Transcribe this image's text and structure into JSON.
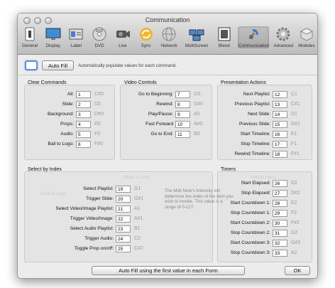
{
  "window": {
    "title": "Communication"
  },
  "toolbar": [
    {
      "label": "General",
      "icon": "general-icon"
    },
    {
      "label": "Display",
      "icon": "display-icon"
    },
    {
      "label": "Label",
      "icon": "label-icon"
    },
    {
      "label": "DVD",
      "icon": "dvd-icon"
    },
    {
      "label": "Live",
      "icon": "live-icon"
    },
    {
      "label": "Sync",
      "icon": "sync-icon"
    },
    {
      "label": "Network",
      "icon": "network-icon"
    },
    {
      "label": "MultiScreen",
      "icon": "multiscreen-icon"
    },
    {
      "label": "Blend",
      "icon": "blend-icon"
    },
    {
      "label": "Communication",
      "icon": "communication-icon",
      "selected": true
    },
    {
      "label": "Advanced",
      "icon": "advanced-icon"
    },
    {
      "label": "Modules",
      "icon": "modules-icon"
    }
  ],
  "top": {
    "autofill_label": "Auto Fill",
    "hint": "Automatically populate values for each command."
  },
  "clear_commands": {
    "title": "Clear Commands",
    "rows": [
      {
        "label": "All:",
        "value": "1",
        "note": "C#0"
      },
      {
        "label": "Slide:",
        "value": "2",
        "note": "D0"
      },
      {
        "label": "Background:",
        "value": "3",
        "note": "D#0"
      },
      {
        "label": "Props:",
        "value": "4",
        "note": "E0"
      },
      {
        "label": "Audio:",
        "value": "5",
        "note": "F0"
      },
      {
        "label": "Bail to Logo:",
        "value": "6",
        "note": "F#0"
      }
    ]
  },
  "video_controls": {
    "title": "Video Controls",
    "rows": [
      {
        "label": "Go to Beginning:",
        "value": "7",
        "note": "G0"
      },
      {
        "label": "Rewind:",
        "value": "8",
        "note": "G#0"
      },
      {
        "label": "Play/Pause:",
        "value": "9",
        "note": "A0"
      },
      {
        "label": "Fast Forward",
        "value": "10",
        "note": "A#0"
      },
      {
        "label": "Go to End:",
        "value": "11",
        "note": "B0"
      }
    ]
  },
  "presentation_actions": {
    "title": "Presentation Actions",
    "rows": [
      {
        "label": "Next Playlist:",
        "value": "12",
        "note": "C1"
      },
      {
        "label": "Previous Playlist:",
        "value": "13",
        "note": "C#1"
      },
      {
        "label": "Next Slide:",
        "value": "14",
        "note": "D1"
      },
      {
        "label": "Previous Slide:",
        "value": "15",
        "note": "D#1"
      },
      {
        "label": "Start Timeline:",
        "value": "16",
        "note": "E1"
      },
      {
        "label": "Stop Timeline:",
        "value": "17",
        "note": "F1"
      },
      {
        "label": "Rewind Timeline:",
        "value": "18",
        "note": "F#1"
      }
    ]
  },
  "select_by_index": {
    "title": "Select by Index",
    "rows": [
      {
        "label": "Select Playlist:",
        "value": "19",
        "note": "G1"
      },
      {
        "label": "Trigger Slide:",
        "value": "20",
        "note": "G#1"
      },
      {
        "label": "Select Video/Image Playlist:",
        "value": "21",
        "note": "A1"
      },
      {
        "label": "Trigger Video/Image:",
        "value": "22",
        "note": "A#1"
      },
      {
        "label": "Select Audio Playlist:",
        "value": "23",
        "note": "B1"
      },
      {
        "label": "Trigger Audio:",
        "value": "24",
        "note": "C2"
      },
      {
        "label": "Toggle Prop on/off:",
        "value": "25",
        "note": "C#2"
      }
    ],
    "info": "The Midi Note's Intensity will determine the index of the item you wish to invoke. This value is a range of 0-127."
  },
  "timers": {
    "title": "Timers",
    "rows": [
      {
        "label": "Start Elapsed:",
        "value": "26",
        "note": "D2"
      },
      {
        "label": "Stop Elapsed:",
        "value": "27",
        "note": "D#2"
      },
      {
        "label": "Start Countdown 1:",
        "value": "28",
        "note": "E2"
      },
      {
        "label": "Stop Countdown 1:",
        "value": "29",
        "note": "F2"
      },
      {
        "label": "Start Countdown 2:",
        "value": "30",
        "note": "F#2"
      },
      {
        "label": "Stop Countdown 2:",
        "value": "31",
        "note": "G2"
      },
      {
        "label": "Start Countdown 3:",
        "value": "32",
        "note": "G#2"
      },
      {
        "label": "Stop Countdown 3:",
        "value": "33",
        "note": "A2"
      }
    ]
  },
  "bottom": {
    "autofill_first_label": "Auto Fill using the first value in each Form",
    "ok_label": "OK"
  }
}
